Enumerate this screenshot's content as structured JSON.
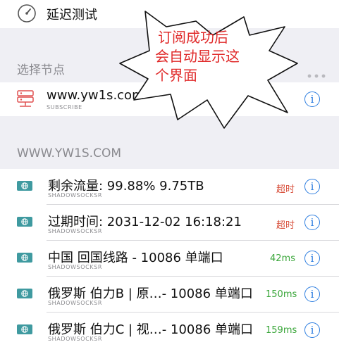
{
  "latency_test": {
    "label": "延迟测试"
  },
  "select_node_header": "选择节点",
  "subscription": {
    "name": "www.yw1s.com",
    "tag": "SUBSCRIBE"
  },
  "group_header": "WWW.YW1S.COM",
  "nodes": [
    {
      "name": "剩余流量:  99.88% 9.75TB",
      "protocol": "SHADOWSOCKSR",
      "status": "超时",
      "status_color": "#d9533f"
    },
    {
      "name": "过期时间:  2031-12-02 16:18:21",
      "protocol": "SHADOWSOCKSR",
      "status": "超时",
      "status_color": "#d9533f"
    },
    {
      "name": "中国 回国线路 - 10086 单端口",
      "protocol": "SHADOWSOCKSR",
      "status": "42ms",
      "status_color": "#3aa63a"
    },
    {
      "name": "俄罗斯 伯力B | 原…- 10086 单端口",
      "protocol": "SHADOWSOCKSR",
      "status": "150ms",
      "status_color": "#3aa63a"
    },
    {
      "name": "俄罗斯 伯力C | 视…- 10086 单端口",
      "protocol": "SHADOWSOCKSR",
      "status": "159ms",
      "status_color": "#3aa63a"
    }
  ],
  "annotation": {
    "line1": "订阅成功后",
    "line2": "会自动显示这",
    "line3": "个界面",
    "color": "#e02a2a"
  },
  "colors": {
    "accent": "#2f7fe0",
    "node_icon": "#3f9aa0",
    "server_icon": "#e05050"
  }
}
